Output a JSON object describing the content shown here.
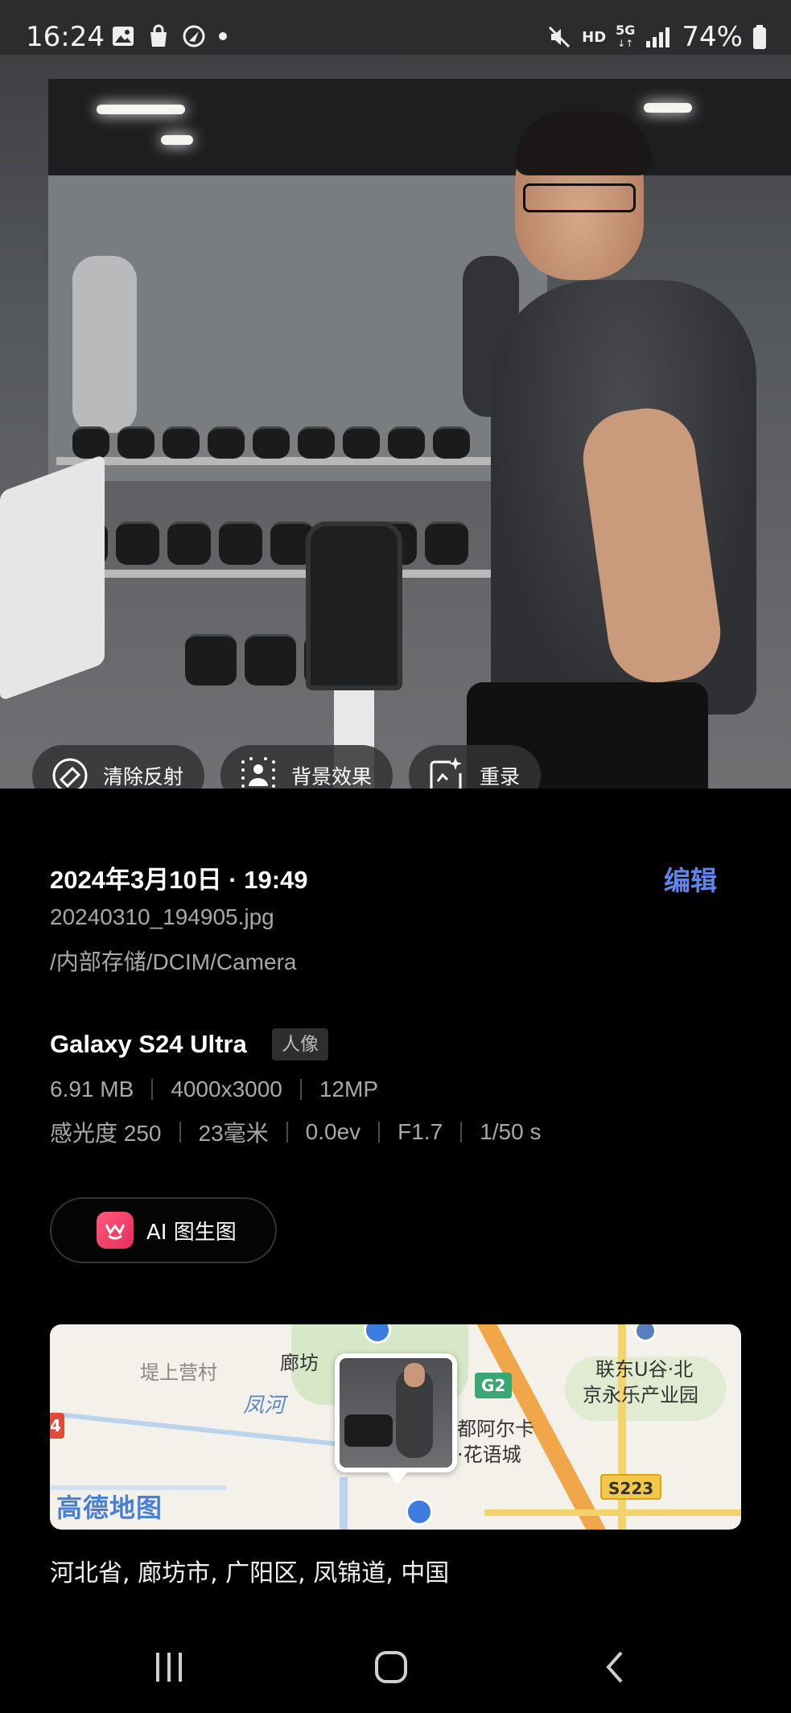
{
  "status_bar": {
    "time": "16:24",
    "battery": "74%",
    "network": "5G",
    "hd": "HD"
  },
  "photo_actions": [
    {
      "label": "清除反射",
      "icon": "clear-reflection-icon"
    },
    {
      "label": "背景效果",
      "icon": "background-effect-icon"
    },
    {
      "label": "重录",
      "icon": "re-record-icon"
    }
  ],
  "details": {
    "date_time": "2024年3月10日 · 19:49",
    "edit_label": "编辑",
    "filename": "20240310_194905.jpg",
    "path": "/内部存储/DCIM/Camera",
    "device": "Galaxy S24 Ultra",
    "mode_badge": "人像",
    "size": "6.91 MB",
    "resolution": "4000x3000",
    "megapixels": "12MP",
    "iso": "感光度 250",
    "focal": "23毫米",
    "ev": "0.0ev",
    "aperture": "F1.7",
    "shutter": "1/50 s"
  },
  "ai_button": {
    "label": "AI 图生图"
  },
  "map": {
    "labels": {
      "village": "堤上营村",
      "langfang": "廊坊",
      "river": "凤河",
      "g2": "G2",
      "arca_1": "都阿尔卡",
      "arca_2": "·花语城",
      "lianddong_1": "联东U谷·北",
      "lianddong_2": "京永乐产业园",
      "s223": "S223",
      "logo": "高德地图",
      "edge_4": "4"
    }
  },
  "address": "河北省, 廊坊市, 广阳区, 凤锦道, 中国",
  "colors": {
    "accent": "#5f86ea",
    "background": "#000000"
  }
}
